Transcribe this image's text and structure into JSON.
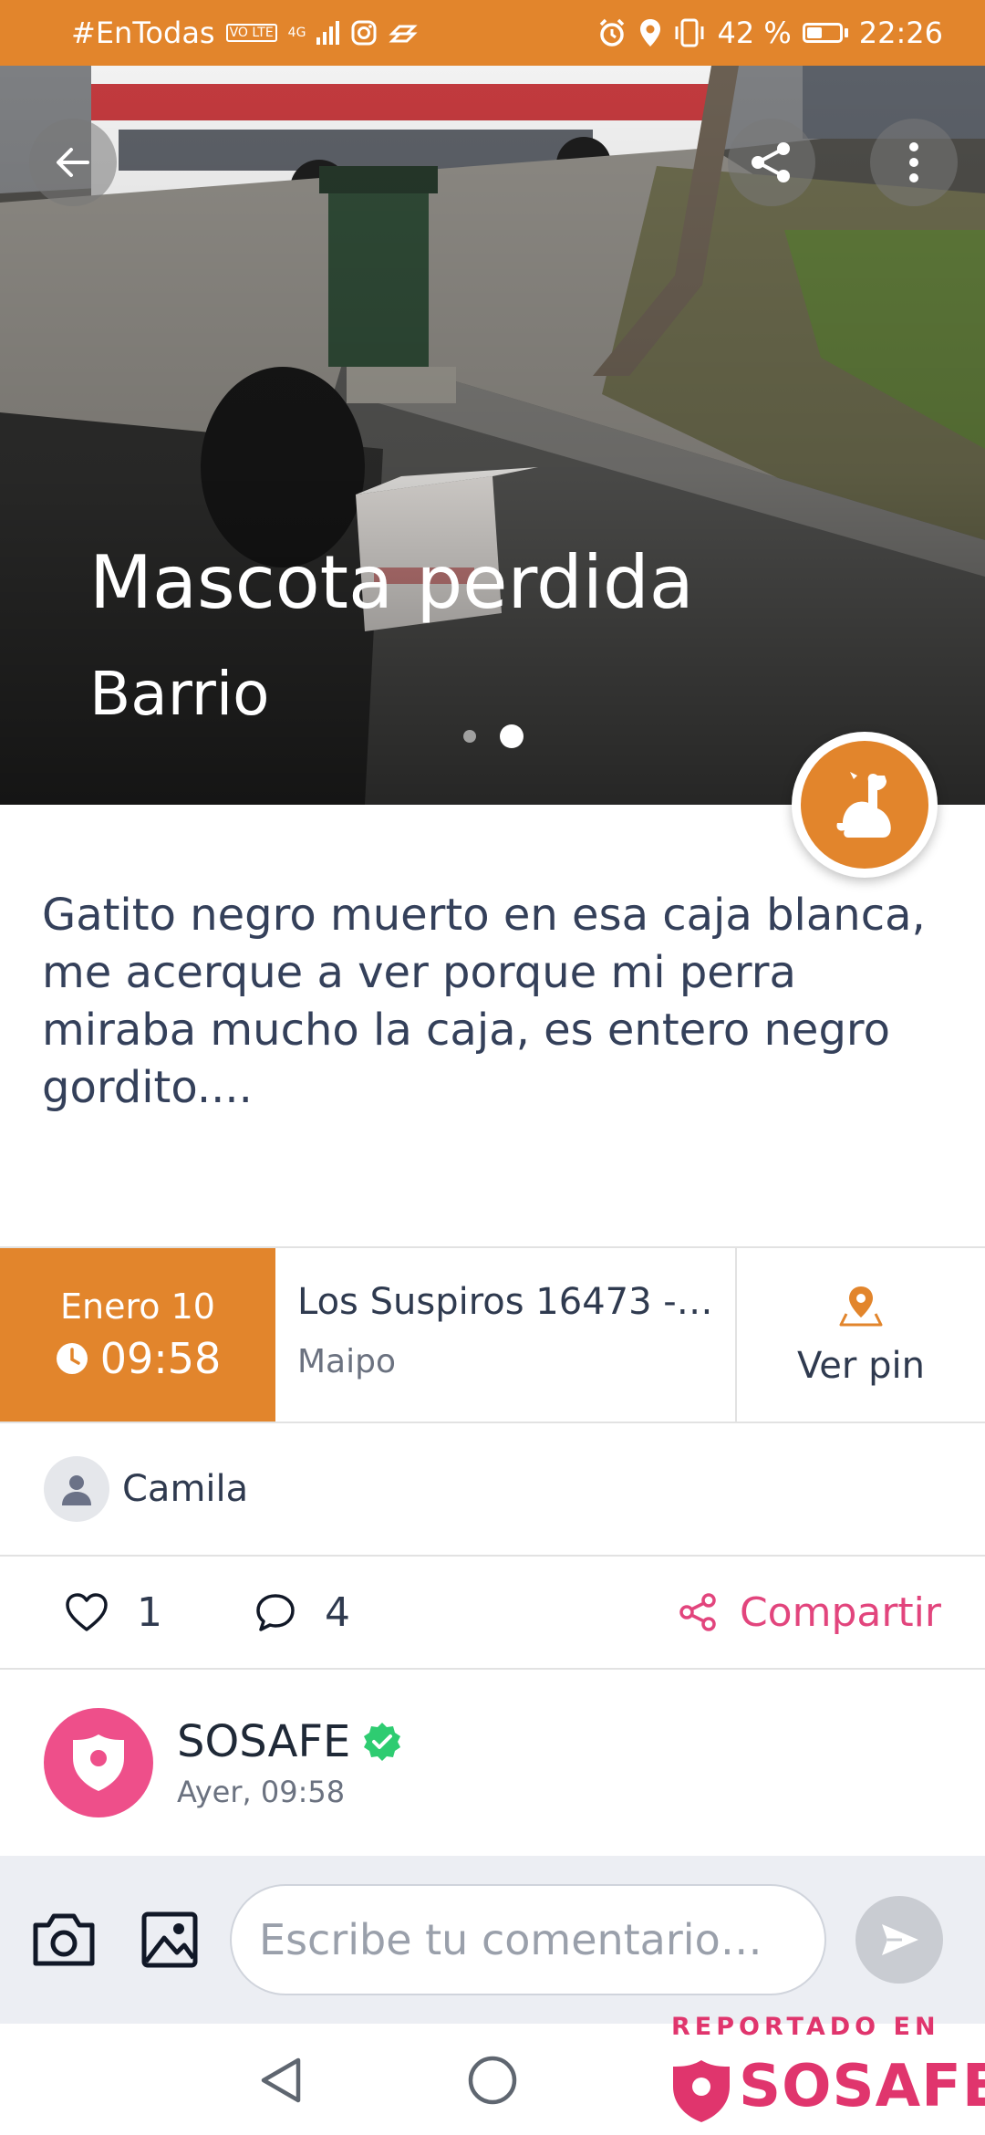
{
  "status_bar": {
    "carrier": "#EnTodas",
    "volte": "VO LTE",
    "network": "4G",
    "battery": "42 %",
    "time": "22:26"
  },
  "post": {
    "category": "Mascota perdida",
    "subcategory": "Barrio",
    "category_icon": "dog-icon",
    "image_index": 2,
    "image_count": 2,
    "description": "Gatito negro muerto en esa caja blanca, me acerque a ver porque mi perra miraba mucho la caja, es entero negro gordito....",
    "date": "Enero 10",
    "time": "09:58",
    "address": "Los Suspiros  16473 -…",
    "city": "Maipo",
    "pin_label": "Ver pin",
    "author": "Camila",
    "likes": "1",
    "comments": "4",
    "share_label": "Compartir"
  },
  "feed_post": {
    "author": "SOSAFE",
    "verified": true,
    "time": "Ayer, 09:58"
  },
  "comment_bar": {
    "placeholder": "Escribe tu comentario…"
  },
  "watermark": {
    "top": "REPORTADO EN",
    "brand": "SOSAFE"
  },
  "colors": {
    "accent": "#e2852c",
    "brand_pink": "#e2457d",
    "verified": "#2ecc71"
  }
}
